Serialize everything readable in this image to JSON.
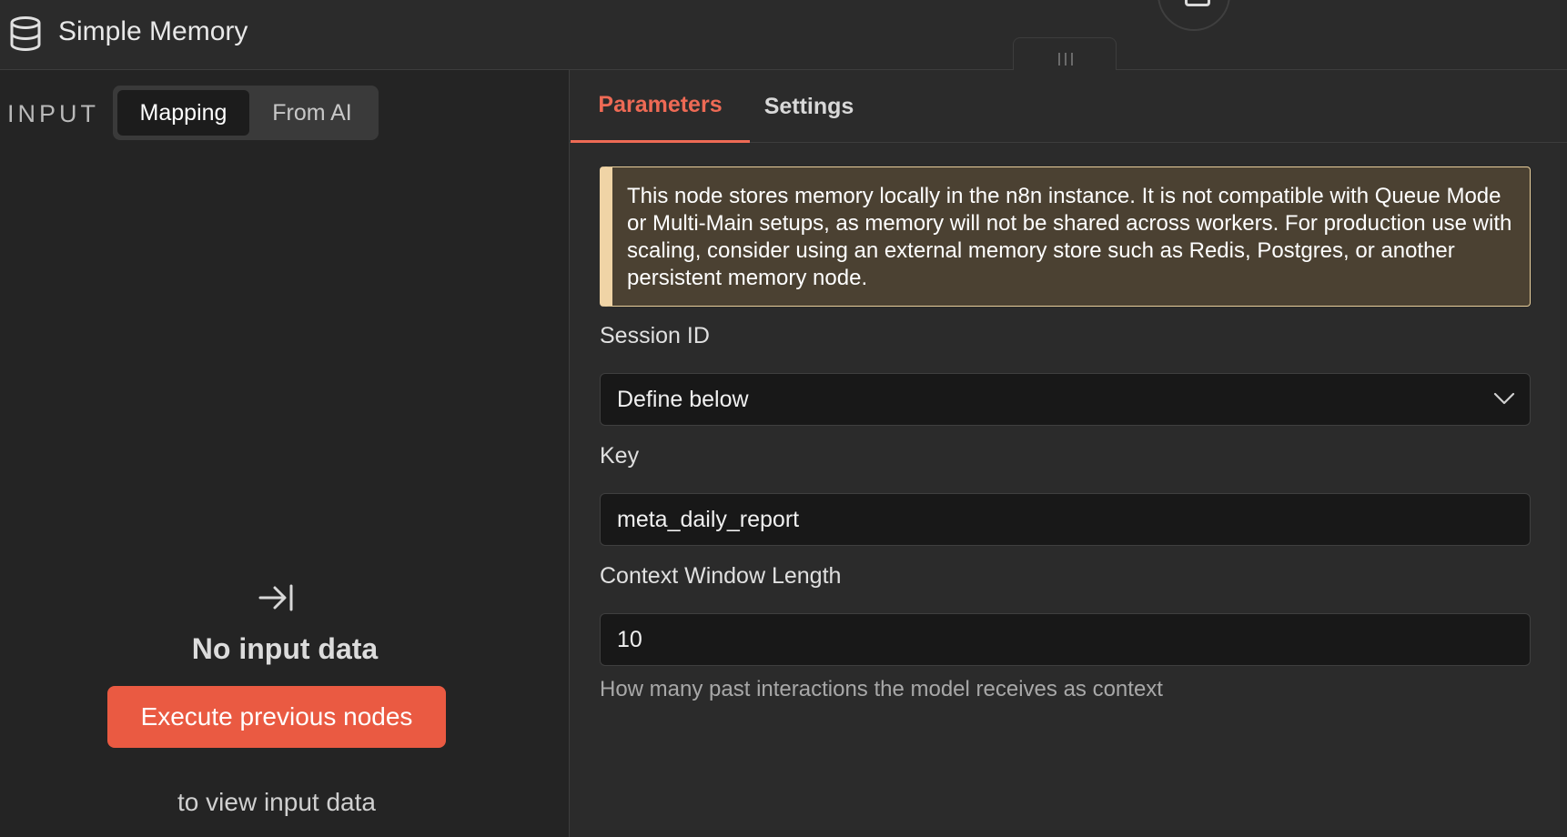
{
  "header": {
    "title": "Simple Memory",
    "node_icon": "database-icon"
  },
  "input_panel": {
    "label": "INPUT",
    "mode_tabs": [
      {
        "label": "Mapping",
        "active": true
      },
      {
        "label": "From AI",
        "active": false
      }
    ],
    "empty_icon": "arrow-to-right-icon",
    "empty_title": "No input data",
    "execute_button": "Execute previous nodes",
    "empty_hint": "to view input data"
  },
  "params_panel": {
    "tabs": [
      {
        "label": "Parameters",
        "active": true
      },
      {
        "label": "Settings",
        "active": false
      }
    ],
    "notice": "This node stores memory locally in the n8n instance. It is not compatible with Queue Mode or Multi-Main setups, as memory will not be shared across workers. For production use with scaling, consider using an external memory store such as Redis, Postgres, or another persistent memory node.",
    "fields": {
      "session_id": {
        "label": "Session ID",
        "value": "Define below",
        "icon": "chevron-down-icon"
      },
      "key": {
        "label": "Key",
        "value": "meta_daily_report"
      },
      "context_window": {
        "label": "Context Window Length",
        "value": "10",
        "hint": "How many past interactions the model receives as context"
      }
    }
  },
  "colors": {
    "accent": "#ea5a42",
    "active_tab": "#ee6a55",
    "notice_bg": "#4b4132",
    "notice_border": "#f0d4a6"
  }
}
